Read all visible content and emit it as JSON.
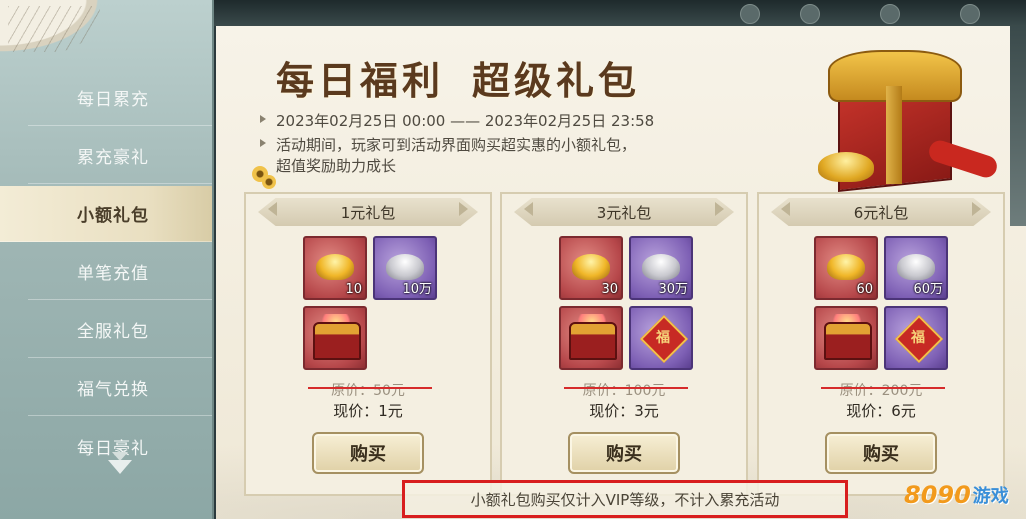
{
  "sidebar": {
    "items": [
      {
        "label": "每日累充"
      },
      {
        "label": "累充豪礼"
      },
      {
        "label": "小额礼包"
      },
      {
        "label": "单笔充值"
      },
      {
        "label": "全服礼包"
      },
      {
        "label": "福气兑换"
      },
      {
        "label": "每日豪礼"
      }
    ],
    "active_index": 2
  },
  "main": {
    "title_part1": "每日福利",
    "title_part2": "超级礼包",
    "date_range": "2023年02月25日 00:00 —— 2023年02月25日 23:58",
    "description_line1": "活动期间，玩家可到活动界面购买超实惠的小额礼包，",
    "description_line2": "超值奖励助力成长"
  },
  "packages": [
    {
      "name": "1元礼包",
      "gold_qty": "10",
      "silver_qty": "10万",
      "original_price": "原价：50元",
      "current_price": "现价：1元",
      "buy_label": "购买"
    },
    {
      "name": "3元礼包",
      "gold_qty": "30",
      "silver_qty": "30万",
      "fu_char": "福",
      "original_price": "原价：100元",
      "current_price": "现价：3元",
      "buy_label": "购买"
    },
    {
      "name": "6元礼包",
      "gold_qty": "60",
      "silver_qty": "60万",
      "fu_char": "福",
      "original_price": "原价：200元",
      "current_price": "现价：6元",
      "buy_label": "购买"
    }
  ],
  "note": "小额礼包购买仅计入VIP等级，不计入累充活动",
  "watermark": {
    "num": "8090",
    "text": "游戏"
  },
  "colors": {
    "strike": "#d62b2b",
    "note_border": "#d81e1e"
  }
}
